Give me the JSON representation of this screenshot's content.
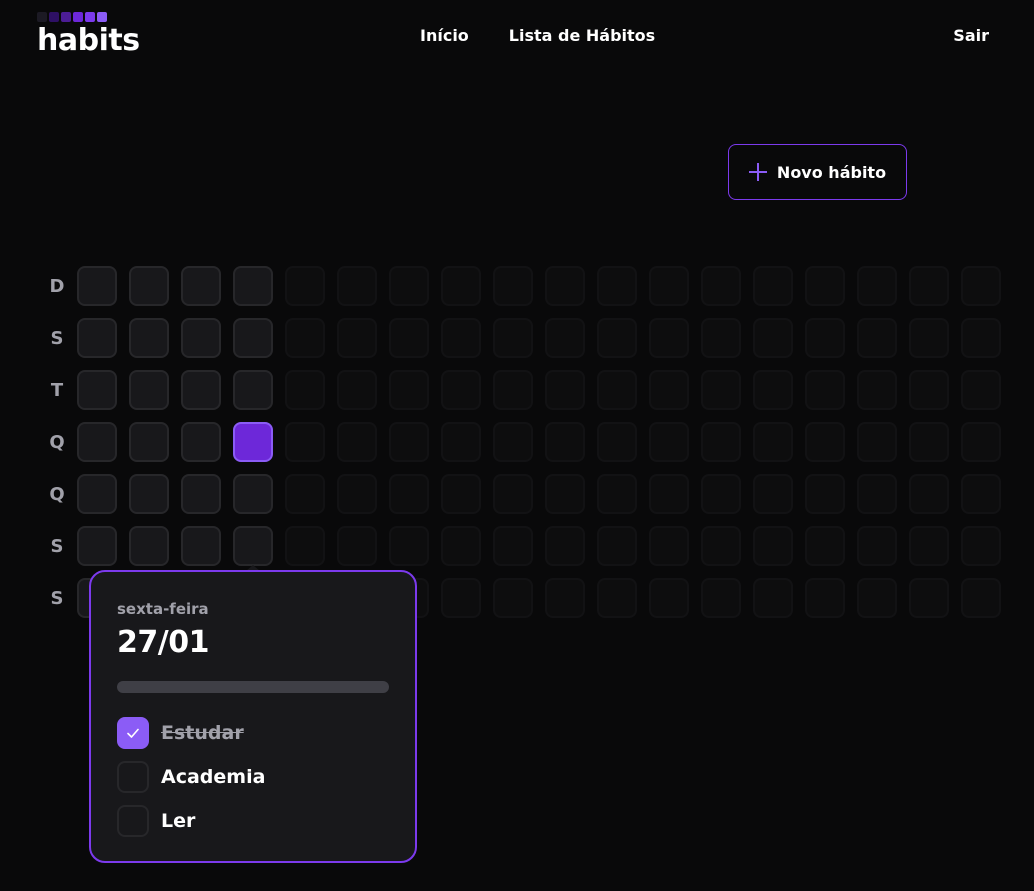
{
  "brand": {
    "name": "habits",
    "square_colors": [
      "#1c1a24",
      "#2e1065",
      "#4c1d95",
      "#6d28d9",
      "#7c3aed",
      "#8b5cf6"
    ]
  },
  "nav": {
    "items": [
      {
        "label": "Início"
      },
      {
        "label": "Lista de Hábitos"
      }
    ],
    "logout_label": "Sair"
  },
  "new_habit_button": {
    "label": "Novo hábito",
    "icon": "plus-icon"
  },
  "weekdays": [
    "D",
    "S",
    "T",
    "Q",
    "Q",
    "S",
    "S"
  ],
  "summary": {
    "weeks": 18,
    "past_days": 25,
    "active_day_index": 25,
    "selected_day_index": 26
  },
  "popover": {
    "weekday": "sexta-feira",
    "date": "27/01",
    "progress": 0.0,
    "habits": [
      {
        "label": "Estudar",
        "completed": true
      },
      {
        "label": "Academia",
        "completed": false
      },
      {
        "label": "Ler",
        "completed": false
      }
    ]
  },
  "colors": {
    "accent": "#7c3aed",
    "accent_light": "#8b5cf6",
    "background": "#09090a",
    "cell": "#18181b",
    "cell_border": "#27272a"
  }
}
